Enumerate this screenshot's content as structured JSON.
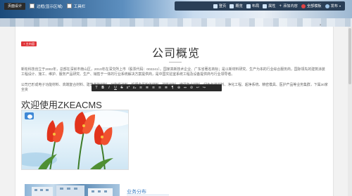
{
  "admin_bar": {
    "design_label": "页面设计",
    "show_zones_label": "边框(显示区域)",
    "toolbar_label": "工具栏",
    "items": [
      {
        "label": "登页",
        "icon": "home-icon"
      },
      {
        "label": "概览",
        "icon": "overview-icon"
      },
      {
        "label": "布局",
        "icon": "layout-icon"
      },
      {
        "label": "属性",
        "icon": "properties-icon"
      },
      {
        "label": "添加内容",
        "icon": "plus-icon"
      },
      {
        "label": "全部模板",
        "icon": "template-icon"
      },
      {
        "label": "发布",
        "icon": "user-icon"
      }
    ]
  },
  "page": {
    "badge": "+ 主内容",
    "title": "公司概览",
    "para1": "新松科技创立于2002年，总部在深圳市南山区，2010年在深交所上市（股票代码：002241）。国家高新技术企业、广东省著名商标；是以新材料研究、生产为本的行业综合服务商，国际领先的建筑涂装工程设计、施工、维护、服务产品研究、生产、销售于一体的行业系统解决方案提供商，是中国实验室系统工程及设备提供商与行业领导者。",
    "para2": "公司已形成电子功能材料、高端复合材料、建筑节能材料、功能性涂料、超细金属粉体材料、磁性材料、增强复合材料、绿色包装材料、净化工程、超净系统、精密模具、医护产品等业务集群，下属30家全资",
    "heading": "欢迎使用ZKEACMS",
    "section_title": "业务分布"
  },
  "editor_toolbar": [
    "T",
    "B",
    "I",
    "U",
    "S",
    "x²",
    "x₂",
    "≡",
    "≣",
    "≡",
    "≡",
    "≣",
    "¶",
    "⊕",
    "⇔",
    "⊘",
    "↩",
    "↪"
  ]
}
